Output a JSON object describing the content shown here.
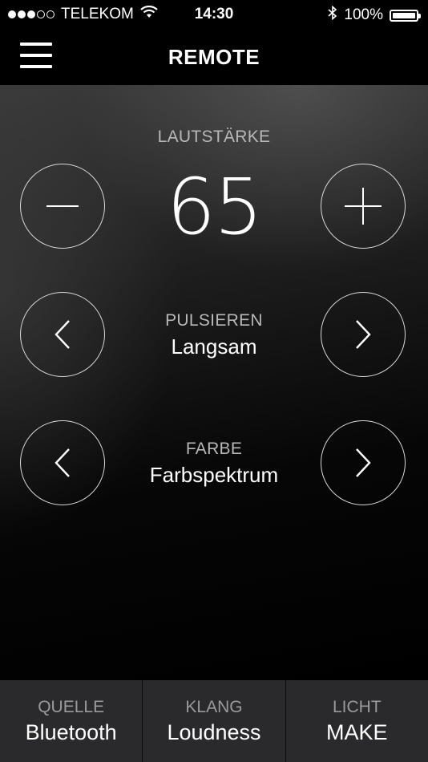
{
  "status_bar": {
    "carrier": "TELEKOM",
    "time": "14:30",
    "battery": "100%",
    "signal_bars_filled": 3,
    "signal_bars_total": 5,
    "icons": [
      "wifi-icon",
      "bluetooth-icon",
      "battery-icon"
    ]
  },
  "nav": {
    "title": "REMOTE",
    "menu_icon": "hamburger-menu-icon"
  },
  "volume": {
    "label": "LAUTSTÄRKE",
    "value": "65",
    "decrease_icon": "minus-icon",
    "increase_icon": "plus-icon"
  },
  "pulse": {
    "label": "PULSIEREN",
    "value": "Langsam",
    "prev_icon": "chevron-left-icon",
    "next_icon": "chevron-right-icon"
  },
  "color": {
    "label": "FARBE",
    "value": "Farbspektrum",
    "prev_icon": "chevron-left-icon",
    "next_icon": "chevron-right-icon"
  },
  "tabs": [
    {
      "label": "QUELLE",
      "value": "Bluetooth"
    },
    {
      "label": "KLANG",
      "value": "Loudness"
    },
    {
      "label": "LICHT",
      "value": "MAKE"
    }
  ],
  "colors": {
    "background": "#000000",
    "tab_bar": "#2a2a2c",
    "label_gray": "#b8b8b8",
    "text": "#ffffff"
  }
}
